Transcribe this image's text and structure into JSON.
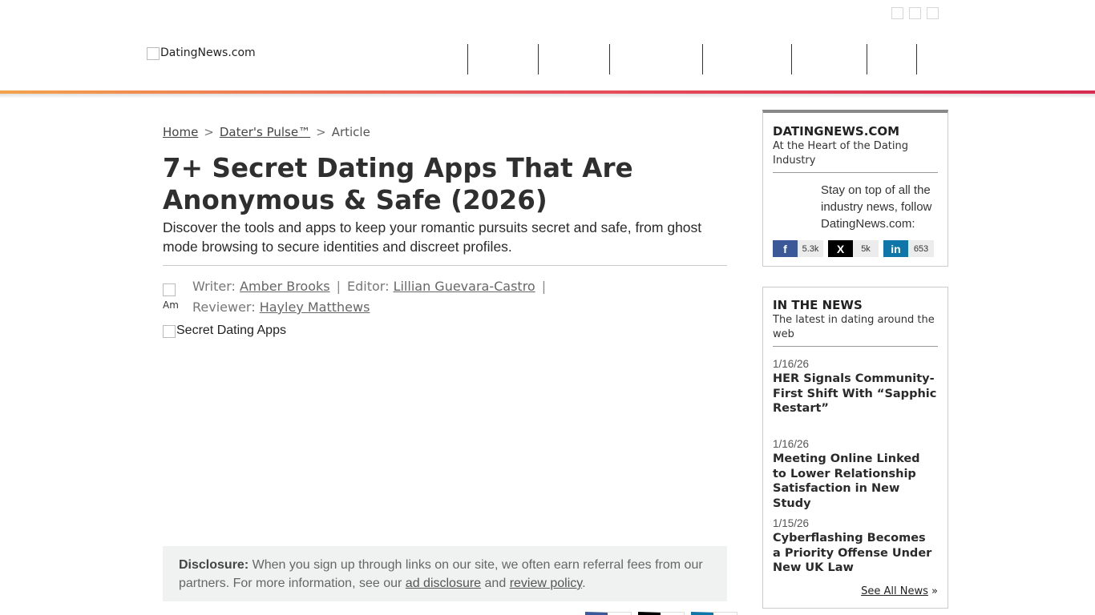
{
  "header": {
    "logo_alt": "DatingNews.com"
  },
  "breadcrumb": {
    "home": "Home",
    "section": "Dater's Pulse™",
    "current": "Article"
  },
  "article": {
    "title": "7+ Secret Dating Apps That Are Anonymous & Safe (2026)",
    "subtitle": "Discover the tools and apps to keep your romantic pursuits secret and safe, from ghost mode browsing to secure identities and discreet profiles.",
    "avatar_alt": "Am",
    "writer_label": "Writer:",
    "writer_name": "Amber Brooks",
    "editor_label": "Editor:",
    "editor_name": "Lillian Guevara-Castro",
    "reviewer_label": "Reviewer:",
    "reviewer_name": "Hayley Matthews",
    "hero_alt": "Secret Dating Apps"
  },
  "disclosure": {
    "label": "Disclosure:",
    "text1": "When you sign up through links on our site, we often earn referral fees from our partners. For more information, see our",
    "link1": "ad disclosure",
    "and": "and",
    "link2": "review policy",
    "end": "."
  },
  "sidebar": {
    "follow_box": {
      "title": "DATINGNEWS.COM",
      "tagline": "At the Heart of the Dating Industry",
      "text": "Stay on top of all the industry news, follow DatingNews.com:",
      "social": [
        {
          "icon": "f",
          "count": "5.3k",
          "color": "#3b5998"
        },
        {
          "icon": "X",
          "count": "5k",
          "color": "#000000"
        },
        {
          "icon": "in",
          "count": "653",
          "color": "#0e76a8"
        }
      ]
    },
    "news_box": {
      "title": "IN THE NEWS",
      "tagline": "The latest in dating around the web",
      "items": [
        {
          "date": "1/16/26",
          "title": "HER Signals Community-First Shift With “Sapphic Restart”"
        },
        {
          "date": "1/16/26",
          "title": "Meeting Online Linked to Lower Relationship Satisfaction in New Study"
        },
        {
          "date": "1/15/26",
          "title": "Cyberflashing Becomes a Priority Offense Under New UK Law"
        }
      ],
      "see_all": "See All News",
      "see_all_arrow": "»"
    }
  }
}
